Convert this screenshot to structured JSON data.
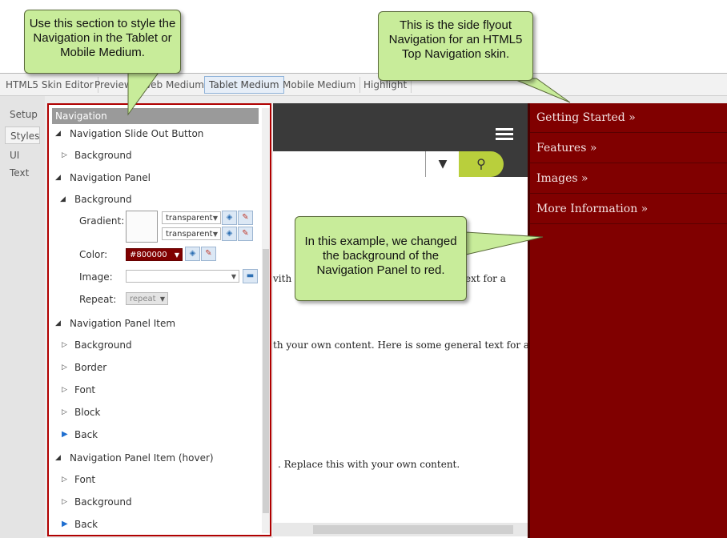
{
  "tabs": [
    "HTML5 Skin Editor",
    "Preview",
    "Web Medium",
    "Tablet Medium",
    "Mobile Medium",
    "Highlight"
  ],
  "active_tab": "Tablet Medium",
  "left_nav": [
    "Setup",
    "Styles",
    "UI Text"
  ],
  "active_left_nav": "Styles",
  "panel": {
    "header": "Navigation",
    "rows": {
      "slide_btn": "Navigation Slide Out Button",
      "bg1": "Background",
      "nav_panel": "Navigation Panel",
      "bg2": "Background",
      "gradient_label": "Gradient:",
      "grad_val1": "transparent",
      "grad_val2": "transparent",
      "color_label": "Color:",
      "color_val": "#800000",
      "image_label": "Image:",
      "repeat_label": "Repeat:",
      "repeat_val": "repeat",
      "panel_item": "Navigation Panel Item",
      "pi_bg": "Background",
      "pi_border": "Border",
      "pi_font": "Font",
      "pi_block": "Block",
      "pi_back": "Back",
      "panel_item_hover": "Navigation Panel Item (hover)",
      "ph_font": "Font",
      "ph_bg": "Background",
      "ph_back": "Back"
    }
  },
  "preview": {
    "line1a": "vith",
    "line1b": "ext for a",
    "line2": "th your own content. Here is some general text for a",
    "line3": ". Replace this with your own content."
  },
  "flyout": {
    "items": [
      "Getting Started  »",
      "Features  »",
      "Images  »",
      "More Information  »"
    ],
    "bg_color": "#800000"
  },
  "callouts": {
    "c1": "Use this section to style the Navigation in the Tablet or Mobile Medium.",
    "c2": "This is the side flyout Navigation for an HTML5 Top Navigation skin.",
    "c3": "In this example, we changed the background of the Navigation Panel to red."
  }
}
